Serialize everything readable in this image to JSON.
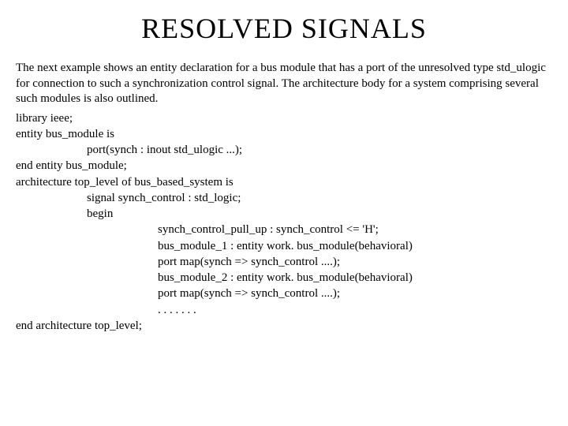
{
  "title": "RESOLVED SIGNALS",
  "intro": "The next example shows an entity declaration for a bus module that has a port of the unresolved type std_ulogic for connection to such a synchronization control signal. The architecture body for a system comprising several such modules is also outlined.",
  "code": {
    "l01": "library ieee;",
    "l02": "entity bus_module is",
    "l03": "port(synch : inout std_ulogic ...);",
    "l04": "end entity bus_module;",
    "l05": "architecture top_level of bus_based_system is",
    "l06": "signal synch_control : std_logic;",
    "l07": "begin",
    "l08": "synch_control_pull_up : synch_control <= 'H';",
    "l09": "bus_module_1 : entity work. bus_module(behavioral)",
    "l10": "port map(synch => synch_control ....);",
    "l11": "bus_module_2 : entity work. bus_module(behavioral)",
    "l12": "port map(synch => synch_control ....);",
    "l13": ". . . . . . .",
    "l14": "end architecture top_level;"
  }
}
